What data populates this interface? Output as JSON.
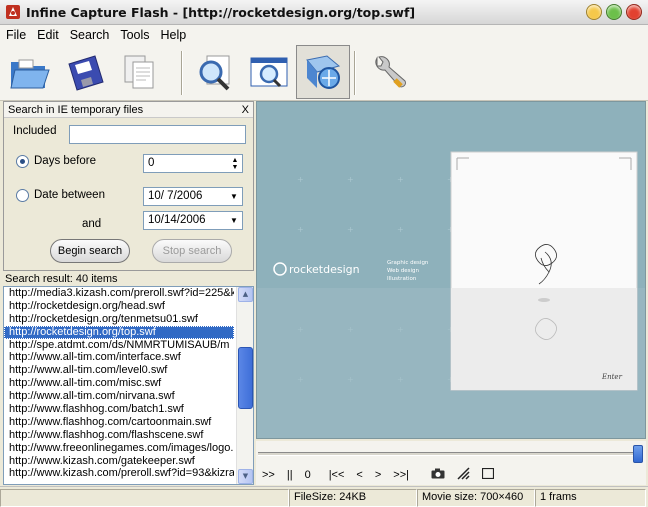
{
  "window": {
    "title": "Infine Capture Flash - [http://rocketdesign.org/top.swf]",
    "colors": {
      "minimize": "#f5c84a",
      "maximize": "#6cc04a",
      "close": "#e2412f"
    }
  },
  "menu": [
    "File",
    "Edit",
    "Search",
    "Tools",
    "Help"
  ],
  "toolbar": {
    "buttons": [
      {
        "icon": "open-folder-icon"
      },
      {
        "icon": "save-floppy-icon"
      },
      {
        "icon": "copy-pages-icon"
      },
      {
        "icon": "magnify-page-icon"
      },
      {
        "icon": "search-window-icon"
      },
      {
        "icon": "ie-cache-icon",
        "active": true
      },
      {
        "icon": "wrench-icon"
      }
    ]
  },
  "search": {
    "header": "Search in IE temporary files",
    "close_glyph": "X",
    "included_label": "Included",
    "included_value": "",
    "days_before_label": "Days before",
    "days_before_value": "0",
    "date_between_label": "Date between",
    "date_from": "10/  7/2006",
    "and_label": "and",
    "date_to": "10/14/2006",
    "begin_button": "Begin search",
    "stop_button": "Stop search"
  },
  "results": {
    "label": "Search result: 40 items",
    "items": [
      "http://media3.kizash.com/preroll.swf?id=225&ki",
      "http://rocketdesign.org/head.swf",
      "http://rocketdesign.org/tenmetsu01.swf",
      "http://rocketdesign.org/top.swf",
      "http://spe.atdmt.com/ds/NMMRTUMISAUB/m",
      "http://www.all-tim.com/interface.swf",
      "http://www.all-tim.com/level0.swf",
      "http://www.all-tim.com/misc.swf",
      "http://www.all-tim.com/nirvana.swf",
      "http://www.flashhog.com/batch1.swf",
      "http://www.flashhog.com/cartoonmain.swf",
      "http://www.flashhog.com/flashscene.swf",
      "http://www.freeonlinegames.com/images/logo.",
      "http://www.kizash.com/gatekeeper.swf",
      "http://www.kizash.com/preroll.swf?id=93&kizrai"
    ],
    "selected_index": 3
  },
  "preview": {
    "brand": "rocketdesign",
    "services": [
      "Graphic design",
      "Web design",
      "Illustration"
    ],
    "enter": "Enter",
    "bg": "#8eb1bb"
  },
  "controls": [
    ">>",
    "||",
    "0",
    "|<<",
    "<",
    ">",
    ">>|"
  ],
  "status": {
    "filesize": "FileSize: 24KB",
    "movie_size": "Movie size: 700×460",
    "frames": "1 frams"
  }
}
